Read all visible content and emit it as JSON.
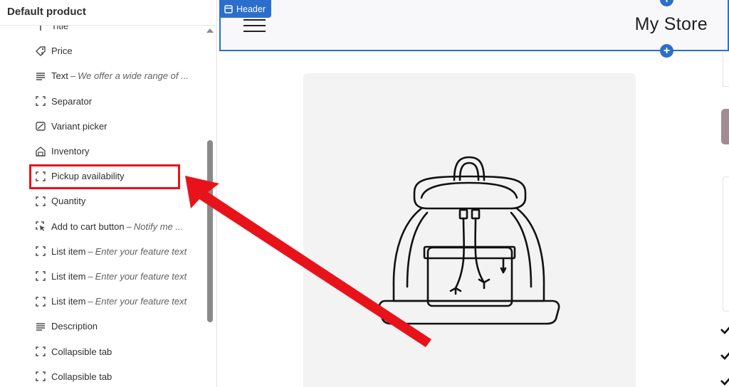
{
  "sidebar": {
    "title": "Default product",
    "items": [
      {
        "label": "Title",
        "sub": "",
        "icon": "title-icon"
      },
      {
        "label": "Price",
        "sub": "",
        "icon": "price-tag-icon"
      },
      {
        "label": "Text",
        "sub": "We offer a wide range of ...",
        "icon": "text-lines-icon"
      },
      {
        "label": "Separator",
        "sub": "",
        "icon": "block-dashed-icon"
      },
      {
        "label": "Variant picker",
        "sub": "",
        "icon": "variant-icon"
      },
      {
        "label": "Inventory",
        "sub": "",
        "icon": "inventory-icon"
      },
      {
        "label": "Pickup availability",
        "sub": "",
        "icon": "block-dashed-icon"
      },
      {
        "label": "Quantity",
        "sub": "",
        "icon": "block-dashed-icon"
      },
      {
        "label": "Add to cart button",
        "sub": "Notify me ...",
        "icon": "cursor-click-icon"
      },
      {
        "label": "List item",
        "sub": "Enter your feature text",
        "icon": "block-dashed-icon"
      },
      {
        "label": "List item",
        "sub": "Enter your feature text",
        "icon": "block-dashed-icon"
      },
      {
        "label": "List item",
        "sub": "Enter your feature text",
        "icon": "block-dashed-icon"
      },
      {
        "label": "Description",
        "sub": "",
        "icon": "text-lines-icon"
      },
      {
        "label": "Collapsible tab",
        "sub": "",
        "icon": "block-dashed-icon"
      },
      {
        "label": "Collapsible tab",
        "sub": "",
        "icon": "block-dashed-icon"
      }
    ]
  },
  "preview": {
    "header_tag": "Header",
    "store_title": "My Store"
  },
  "colors": {
    "accent": "#2c6ecb",
    "annotation": "#e8131a"
  }
}
